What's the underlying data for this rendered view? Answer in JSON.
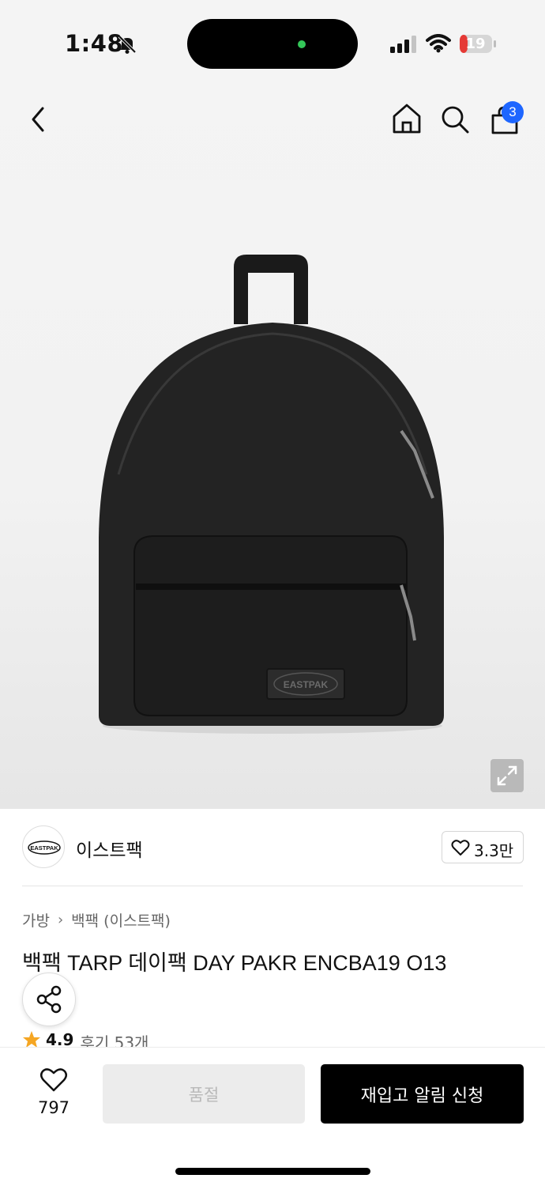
{
  "status_bar": {
    "time": "1:48",
    "battery": "19"
  },
  "nav": {
    "cart_count": "3"
  },
  "product_image": {
    "logo_text": "EASTPAK"
  },
  "brand": {
    "logo_text": "EASTPAK",
    "name": "이스트팩",
    "likes": "3.3만"
  },
  "breadcrumb": [
    "가방",
    "백팩 (이스트팩)"
  ],
  "product": {
    "title": "백팩 TARP 데이팩 DAY PAKR ENCBA19 O13",
    "rating": "4.9",
    "reviews": "후기 53개"
  },
  "bottom_bar": {
    "wish_count": "797",
    "soldout_label": "품절",
    "restock_label": "재입고 알림 신청"
  },
  "colors": {
    "accent": "#1e66ff",
    "star": "#f5a623",
    "primary_button": "#000000",
    "disabled_button": "#ececec"
  }
}
